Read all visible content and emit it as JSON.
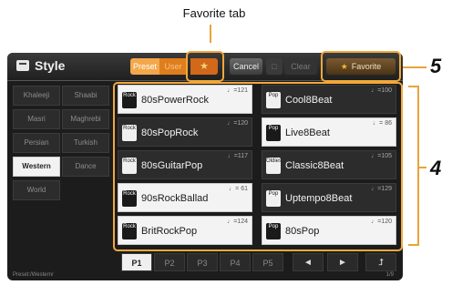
{
  "callouts": {
    "favorite_tab_label": "Favorite tab",
    "num5": "5",
    "num4": "4"
  },
  "titlebar": {
    "icon": "style-icon",
    "title": "Style",
    "tabs": {
      "preset": "Preset",
      "user": "User",
      "favorite": "★"
    },
    "cancel": "Cancel",
    "disabled_btn": "□",
    "clear": "Clear",
    "favorite_star": "★",
    "favorite_label": "Favorite"
  },
  "genres": [
    {
      "left": "Khaleeji",
      "right": "Shaabi"
    },
    {
      "left": "Masri",
      "right": "Maghrebi"
    },
    {
      "left": "Persian",
      "right": "Turkish"
    },
    {
      "left": "Western",
      "right": "Dance"
    },
    {
      "left": "World",
      "right": ""
    }
  ],
  "active_genre": "Western",
  "styles": [
    {
      "name": "80sPowerRock",
      "tempo": "♩=121",
      "icon": "Rock",
      "theme": "light"
    },
    {
      "name": "Cool8Beat",
      "tempo": "♩=100",
      "icon": "Pop",
      "theme": "dark"
    },
    {
      "name": "80sPopRock",
      "tempo": "♩=120",
      "icon": "Rock",
      "theme": "dark"
    },
    {
      "name": "Live8Beat",
      "tempo": "♩= 86",
      "icon": "Pop",
      "theme": "light"
    },
    {
      "name": "80sGuitarPop",
      "tempo": "♩=117",
      "icon": "Rock",
      "theme": "dark"
    },
    {
      "name": "Classic8Beat",
      "tempo": "♩=105",
      "icon": "Oldies",
      "theme": "dark"
    },
    {
      "name": "90sRockBallad",
      "tempo": "♩= 61",
      "icon": "Rock",
      "theme": "light"
    },
    {
      "name": "Uptempo8Beat",
      "tempo": "♩=129",
      "icon": "Pop",
      "theme": "dark"
    },
    {
      "name": "BritRockPop",
      "tempo": "♩=124",
      "icon": "Rock",
      "theme": "light"
    },
    {
      "name": "80sPop",
      "tempo": "♩=120",
      "icon": "Pop",
      "theme": "light"
    }
  ],
  "pages": [
    "P1",
    "P2",
    "P3",
    "P4",
    "P5"
  ],
  "active_page": "P1",
  "nav": {
    "prev": "◄",
    "next": "►",
    "up": "⮥"
  },
  "status": {
    "path": "Preset:/Western/",
    "page": "1/9"
  },
  "colors": {
    "accent": "#f2a83a",
    "tab_orange": "#e07d1c"
  }
}
